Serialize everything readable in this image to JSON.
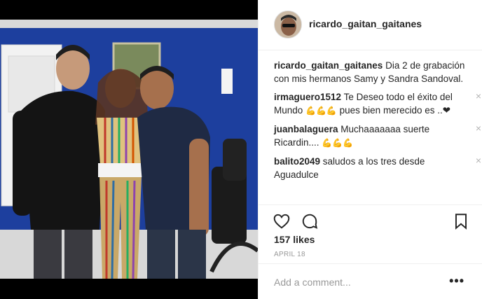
{
  "post": {
    "username": "ricardo_gaitan_gaitanes",
    "photo_description": "Three people posing in front of a blue wall"
  },
  "comments": [
    {
      "user": "ricardo_gaitan_gaitanes",
      "text": "Dia 2 de grabación con mis hermanos Samy y Sandra Sandoval.",
      "emoji": "",
      "suffix": "",
      "closable": false
    },
    {
      "user": "irmaguero1512",
      "text": "Te Deseo todo el éxito del Mundo",
      "emoji": "💪💪💪",
      "suffix": "pues bien merecido es ..❤",
      "closable": true
    },
    {
      "user": "juanbalaguera",
      "text": "Muchaaaaaaa suerte Ricardin....",
      "emoji": "💪💪💪",
      "suffix": "",
      "closable": true
    },
    {
      "user": "balito2049",
      "text": "saludos a los tres desde Aguadulce",
      "emoji": "",
      "suffix": "",
      "closable": true
    }
  ],
  "close_glyph": "×",
  "likes": "157 likes",
  "date": "APRIL 18",
  "add_comment": {
    "placeholder": "Add a comment..."
  },
  "more_glyph": "•••",
  "icons": [
    "heart-icon",
    "comment-icon",
    "bookmark-icon",
    "more-options-icon"
  ],
  "colors": {
    "wall": "#1d3f9e",
    "text": "#262626",
    "muted": "#999999"
  }
}
